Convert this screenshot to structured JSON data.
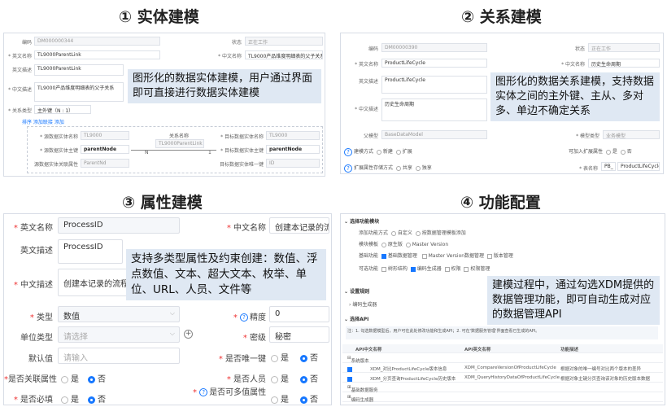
{
  "titles": {
    "t1": "① 实体建模",
    "t2": "② 关系建模",
    "t3": "③ 属性建模",
    "t4": "④ 功能配置"
  },
  "panel1": {
    "code_label": "编码",
    "code_value": "DM000000344",
    "status_label": "状态",
    "status_value": "正在工作",
    "en_name_label": "* 英文名称",
    "en_name_value": "TL9000ParentLink",
    "cn_name_label": "* 中文名称",
    "cn_name_value": "TL9000产品维度明细表的父子关系",
    "en_desc_label": "英文描述",
    "en_desc_value": "TL9000ParentLink",
    "cn_desc_label": "* 中文描述",
    "cn_desc_value": "TL9000产品维度明细表的父子关系",
    "rel_type_label": "* 关系类型",
    "rel_type_value": "主外键（N : 1）",
    "tab_text": "排序  添加联接  添加",
    "left1_label": "* 源数据实体名称",
    "left1_value": "TL9000",
    "left2_label": "* 源数据实体主键",
    "left2_value": "parentNode",
    "left3_label": "源数据实体关联属性",
    "left3_value": "ParentNd",
    "mid_label": "关系名称",
    "mid_value": "TL9000ParentLink",
    "n_label": "N",
    "one_label": "1",
    "right1_label": "* 目标数据实体名称",
    "right1_value": "TL9000",
    "right2_label": "* 目标数据实体主键",
    "right2_value": "parentNode",
    "right3_label": "目标数据实体唯一键",
    "right3_value": "ID",
    "callout": "图形化的数据实体建模，用户通过界面即可直接进行数据实体建模"
  },
  "panel2": {
    "code_label": "编码",
    "code_value": "DM00000390",
    "status_label": "状态",
    "status_value": "正在工作",
    "en_name_label": "* 英文名称",
    "en_name_value": "ProductLifeCycle",
    "cn_name_label": "* 中文名称",
    "cn_name_value": "历史生命周期",
    "en_desc_label": "英文描述",
    "en_desc_value": "ProductLifeCycle",
    "cn_desc_label": "* 中文描述",
    "cn_desc_value": "历史生命周期",
    "parent_label": "父模型",
    "parent_value": "BaseDataModel",
    "model_type_label": "* 模型类型",
    "model_type_value": "业务模型",
    "mode_label": "建模方式",
    "mode_opt1": "新建",
    "mode_opt2": "扩展",
    "ext_label": "可加入扩展属性",
    "ext_opt1": "是",
    "ext_opt2": "否",
    "attr_label": "扩展属性存储方式",
    "attr_opt1": "共享",
    "attr_opt2": "独享",
    "table_label": "* 表名称",
    "table_prefix": "PB_",
    "table_value": "ProductLifeCycle",
    "callout": "图形化的数据关系建模，支持数据实体之间的主外键、主从、多对多、单边不确定关系"
  },
  "panel3": {
    "en_name_label": "英文名称",
    "en_name_value": "ProcessID",
    "cn_name_label": "中文名称",
    "cn_name_value": "创建本记录的流程ID",
    "en_desc_label": "英文描述",
    "en_desc_value": "ProcessID",
    "cn_desc_label": "中文描述",
    "cn_desc_value": "创建本记录的流程ID",
    "type_label": "类型",
    "type_value": "数值",
    "precision_label": "精度",
    "precision_value": "0",
    "unit_label": "单位类型",
    "unit_placeholder": "请选择",
    "secret_label": "密级",
    "secret_value": "秘密",
    "default_label": "默认值",
    "default_placeholder": "请输入",
    "unique_label": "是否唯一键",
    "yes": "是",
    "no": "否",
    "related_label": "是否关联属性",
    "person_label": "是否人员",
    "required_label": "是否必填",
    "multi_label": "是否可多值属性",
    "callout": "支持多类型属性及约束创建：数值、浮点数值、文本、超大文本、枚举、单位、URL、人员、文件等"
  },
  "panel4": {
    "section1": "选择功能模块",
    "row1_label": "添加功能方式",
    "row1_opt1": "自定义",
    "row1_opt2": "按数据管理模板添加",
    "row2_label": "模块模板",
    "row2_opt1": "原生版",
    "row2_opt2": "Master Version",
    "row3_label": "基础功能",
    "row3_opt1": "基础数据管理",
    "row3_opt2": "Master Version数据管理",
    "row3_opt3": "版本管理",
    "row4_label": "可选功能",
    "row4_opt1": "树形结构",
    "row4_opt2": "编码生成器",
    "row4_opt3": "权限",
    "row4_opt4": "权限管理",
    "section2": "设置规则",
    "sub2": "编码生成器",
    "section3": "选择API",
    "note": "注：1. 勾选数据模型后，用户可在此处修改功能和生成API；2. 可在'数据服务管理'界面查看已生成的API。",
    "col1": "API中文名称",
    "col2": "API英文名称",
    "col3": "功能描述",
    "group1": "系统版本",
    "api1_cn": "XDM_对比ProductLifeCycle版本信息",
    "api1_en": "XDM_CompareVersionOfProductLifeCycle",
    "api1_desc": "根据对象的唯一编号对比两个版本的差异",
    "api2_cn": "XDM_分页查询ProductLifeCycle历史版本",
    "api2_en": "XDM_QueryHistoryDataOfProductLifeCycle",
    "api2_desc": "根据对象主键分页查询该对象的历史版本数据",
    "group2": "基础数据服务",
    "group3": "编码生成器",
    "callout": "建模过程中，通过勾选XDM提供的数据管理功能，即可自动生成对应的数据管理API"
  }
}
